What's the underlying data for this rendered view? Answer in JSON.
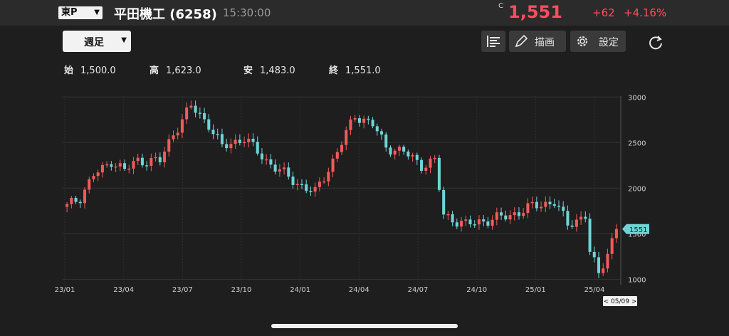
{
  "header": {
    "market": "東P",
    "stock_name": "平田機工 (6258)",
    "time": "15:30:00",
    "price_flag": "C",
    "price": "1,551",
    "change": "+62",
    "change_pct": "+4.16%"
  },
  "toolbar": {
    "period": "週足",
    "draw_label": "描画",
    "settings_label": "設定"
  },
  "ohlc": {
    "open_label": "始",
    "open": "1,500.0",
    "high_label": "高",
    "high": "1,623.0",
    "low_label": "安",
    "low": "1,483.0",
    "close_label": "終",
    "close": "1,551.0"
  },
  "colors": {
    "up": "#f25a5a",
    "down": "#6fd3d6",
    "accent": "#ff4d5e"
  },
  "chart_data": {
    "type": "candlestick",
    "x_ticks": [
      "23/01",
      "23/04",
      "23/07",
      "23/10",
      "24/01",
      "24/04",
      "24/07",
      "24/10",
      "25/01",
      "25/04"
    ],
    "y_ticks": [
      1000,
      1500,
      2000,
      2500,
      3000
    ],
    "ylim": [
      940,
      3010
    ],
    "current_value": "1551",
    "date_marker": "< 05/09 >",
    "grid": true,
    "keyframes": [
      [
        0,
        1800
      ],
      [
        3,
        1900
      ],
      [
        6,
        2150
      ],
      [
        8,
        2200
      ],
      [
        10,
        2300
      ],
      [
        13,
        2200
      ],
      [
        16,
        2300
      ],
      [
        21,
        2300
      ],
      [
        24,
        2600
      ],
      [
        28,
        2900
      ],
      [
        32,
        2700
      ],
      [
        35,
        2450
      ],
      [
        40,
        2550
      ],
      [
        45,
        2300
      ],
      [
        52,
        2050
      ],
      [
        56,
        1950
      ],
      [
        60,
        2300
      ],
      [
        65,
        2800
      ],
      [
        69,
        2700
      ],
      [
        72,
        2450
      ],
      [
        76,
        2400
      ],
      [
        80,
        2250
      ],
      [
        83,
        2300
      ],
      [
        85,
        1700
      ],
      [
        90,
        1600
      ],
      [
        95,
        1650
      ],
      [
        100,
        1700
      ],
      [
        105,
        1800
      ],
      [
        110,
        1850
      ],
      [
        113,
        1600
      ],
      [
        117,
        1700
      ],
      [
        118,
        1300
      ],
      [
        120,
        1050
      ],
      [
        124,
        1551
      ]
    ]
  }
}
